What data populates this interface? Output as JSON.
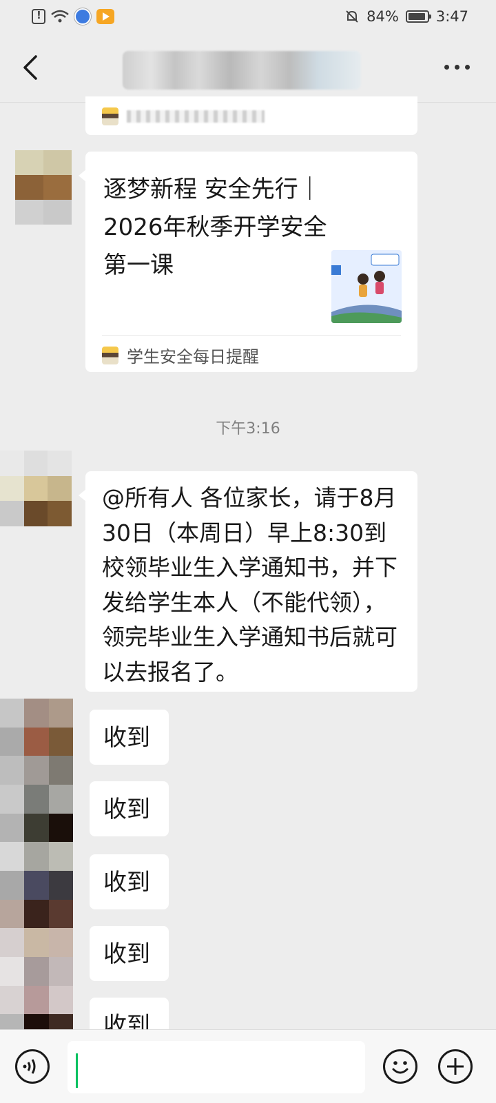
{
  "status_bar": {
    "battery": "84%",
    "time": "3:47",
    "icons": [
      "alert-icon",
      "wifi-icon",
      "globe-app-icon",
      "video-app-icon",
      "mute-bell-icon",
      "battery-icon"
    ]
  },
  "navbar": {
    "back_icon": "chevron-left-icon",
    "more_icon": "more-dots-icon"
  },
  "messages": {
    "article": {
      "title": "逐梦新程 安全先行｜2026年秋季开学安全第一课",
      "source": "学生安全每日提醒"
    },
    "timestamp": "下午3:16",
    "notice": "@所有人  各位家长，请于8月30日（本周日）早上8:30到校领毕业生入学通知书，并下发给学生本人（不能代领），领完毕业生入学通知书后就可以去报名了。",
    "replies": [
      "收到",
      "收到",
      "收到",
      "收到",
      "收到"
    ]
  },
  "input_bar": {
    "voice_icon": "voice-icon",
    "emoji_icon": "emoji-icon",
    "plus_icon": "plus-icon"
  },
  "colors": {
    "background": "#ededed",
    "bubble": "#ffffff",
    "accent": "#07c160"
  }
}
